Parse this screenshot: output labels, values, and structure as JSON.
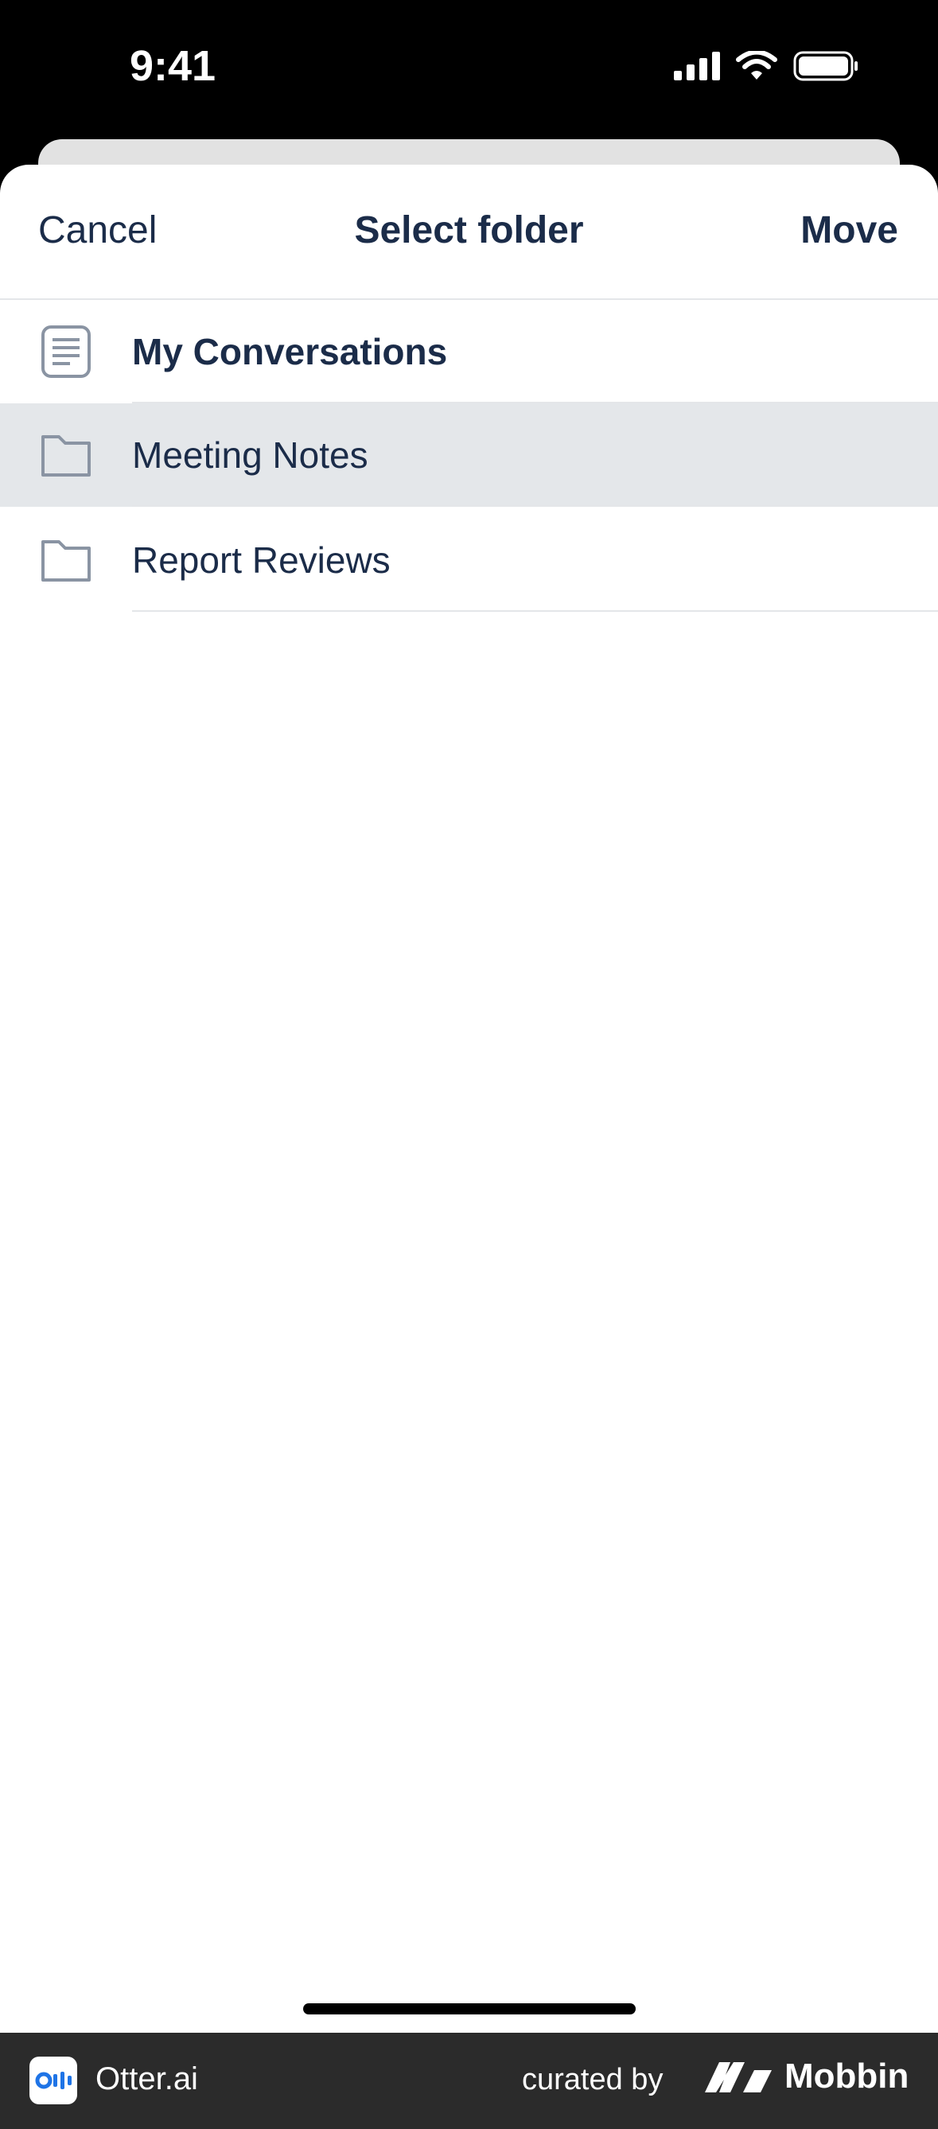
{
  "status_bar": {
    "time": "9:41"
  },
  "nav": {
    "cancel_label": "Cancel",
    "title": "Select folder",
    "move_label": "Move"
  },
  "folders": [
    {
      "label": "My Conversations",
      "icon": "document-icon",
      "bold": true,
      "selected": false
    },
    {
      "label": "Meeting Notes",
      "icon": "folder-icon",
      "bold": false,
      "selected": true
    },
    {
      "label": "Report Reviews",
      "icon": "folder-icon",
      "bold": false,
      "selected": false
    }
  ],
  "footer": {
    "app_name": "Otter.ai",
    "curated_by": "curated by",
    "brand": "Mobbin"
  },
  "colors": {
    "text": "#1b2c49",
    "selected_row": "#e4e7ea",
    "icon": "#8a94a3",
    "otter_blue": "#1f74e6"
  }
}
